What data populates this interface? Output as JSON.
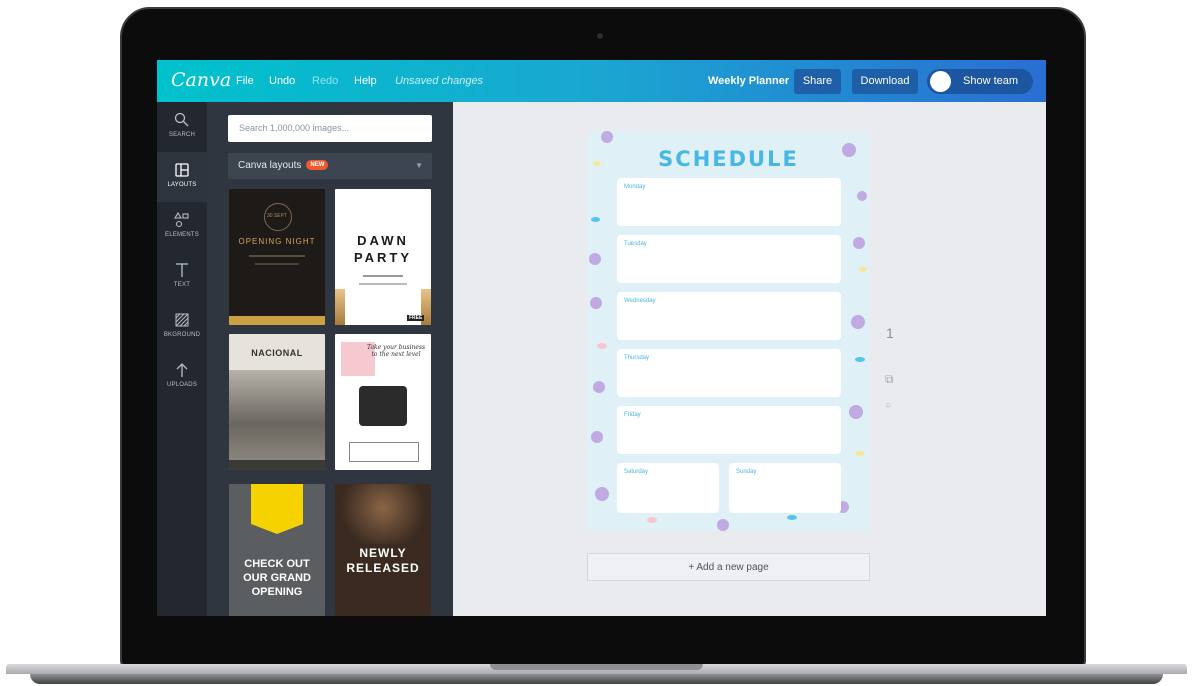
{
  "app": {
    "logo": "Canva",
    "menu": [
      "File",
      "Undo",
      "Redo",
      "Help"
    ],
    "status": "Unsaved changes",
    "design_title": "Weekly Planner",
    "share_label": "Share",
    "download_label": "Download",
    "show_team_label": "Show team"
  },
  "sidebar": {
    "tools": [
      {
        "label": "SEARCH",
        "icon": "search-icon"
      },
      {
        "label": "LAYOUTS",
        "icon": "layouts-icon"
      },
      {
        "label": "ELEMENTS",
        "icon": "elements-icon"
      },
      {
        "label": "TEXT",
        "icon": "text-icon"
      },
      {
        "label": "BKGROUND",
        "icon": "background-icon"
      },
      {
        "label": "UPLOADS",
        "icon": "uploads-icon"
      }
    ]
  },
  "panel": {
    "search_placeholder": "Search 1,000,000 images...",
    "dropdown_label": "Canva layouts",
    "new_badge": "NEW",
    "templates": [
      {
        "title": "OPENING NIGHT",
        "subtitle": "30 SEPT"
      },
      {
        "title": "DAWN",
        "title2": "PARTY",
        "free": "FREE"
      },
      {
        "title": "NACIONAL"
      },
      {
        "title": "Take your business to the next level"
      },
      {
        "title": "CHECK OUT",
        "title2": "OUR GRAND",
        "title3": "OPENING"
      },
      {
        "title": "NEWLY",
        "title2": "RELEASED"
      }
    ]
  },
  "canvas": {
    "schedule_title": "SCHEDULE",
    "days": [
      "Monday",
      "Tuesday",
      "Wednesday",
      "Thursday",
      "Friday",
      "Saturday",
      "Sunday"
    ],
    "add_page_label": "+ Add a new page",
    "page_number": "1"
  },
  "colors": {
    "topbar_start": "#00c2cc",
    "topbar_end": "#2a6ed3",
    "sidebar": "#232830",
    "panel": "#2f3640",
    "schedule_accent": "#47b7e6",
    "dot_purple": "#c1a9e4",
    "dot_blue": "#56c4ec",
    "dot_yellow": "#f7e79a",
    "dot_pink": "#f8c5d2"
  }
}
